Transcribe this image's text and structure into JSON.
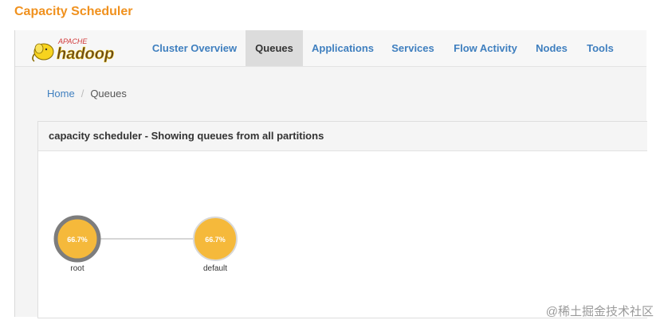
{
  "page": {
    "title": "Capacity Scheduler"
  },
  "header": {
    "logo": {
      "text_top": "APACHE",
      "text_main": "hadoop"
    },
    "nav": [
      {
        "label": "Cluster Overview",
        "active": false
      },
      {
        "label": "Queues",
        "active": true
      },
      {
        "label": "Applications",
        "active": false
      },
      {
        "label": "Services",
        "active": false
      },
      {
        "label": "Flow Activity",
        "active": false
      },
      {
        "label": "Nodes",
        "active": false
      },
      {
        "label": "Tools",
        "active": false
      }
    ]
  },
  "breadcrumb": {
    "home": "Home",
    "current": "Queues"
  },
  "panel": {
    "heading": "capacity scheduler - Showing queues from all partitions",
    "queues": [
      {
        "name": "root",
        "capacity_label": "66.7%"
      },
      {
        "name": "default",
        "capacity_label": "66.7%"
      }
    ]
  },
  "colors": {
    "accent": "#f0911e",
    "link": "#3f7fbf",
    "queue_fill": "#f5b93b",
    "root_ring": "#7d7d7d",
    "default_ring": "#d8d8d8"
  },
  "watermark": "@稀土掘金技术社区"
}
